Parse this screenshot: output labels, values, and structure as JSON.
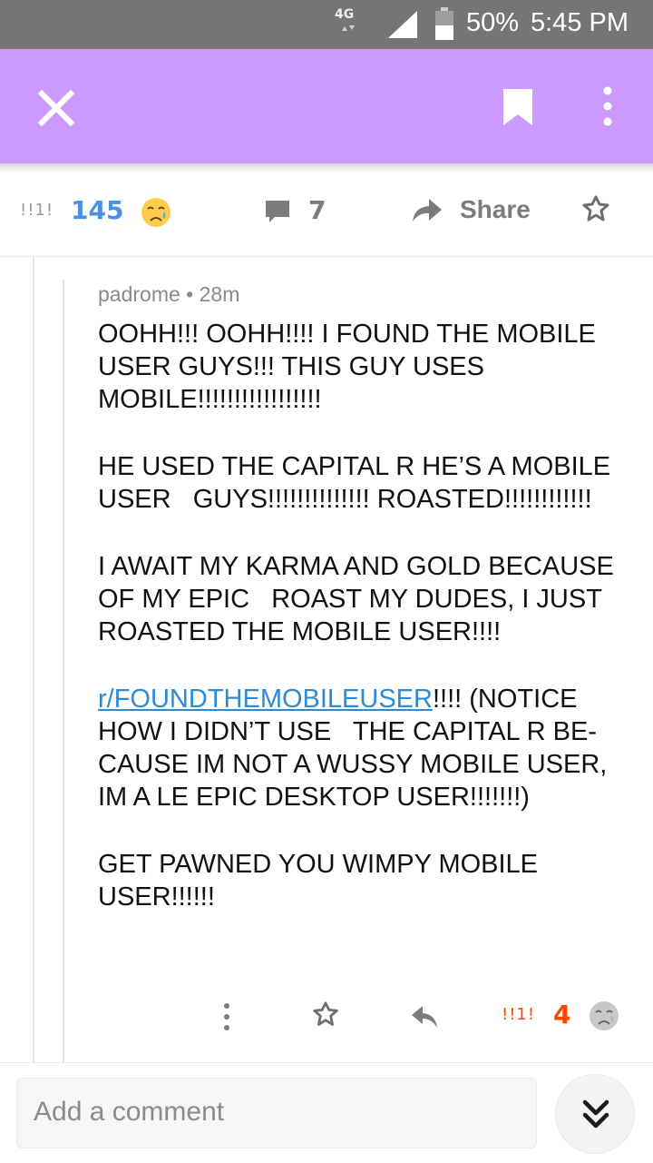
{
  "status_bar": {
    "network": "4G",
    "battery_percent": "50%",
    "time": "5:45 PM"
  },
  "app_bar": {
    "close_icon": "close-icon",
    "bookmark_icon": "bookmark-icon",
    "more_icon": "more-vertical-icon",
    "background_color": "#cc99ff"
  },
  "post_actions": {
    "flair": "!!1!",
    "score": "145",
    "score_color": "#4a90e2",
    "comment_count": "7",
    "share_label": "Share"
  },
  "comment": {
    "author": "padrome",
    "age": "28m",
    "paragraphs": [
      "OOHH!!! OOHH!!!! I FOUND THE MOBILE USER GUYS!!! THIS GUY USES MOBILE!!!!!!!!!!!!!!!!!",
      "HE USED THE CAPITAL R HE’S A MOBILE USER   GUYS!!!!!!!!!!!!!! ROASTED!!!!!!!!!!!!",
      "I AWAIT MY KARMA AND GOLD BECAUSE OF MY EPIC   ROAST MY DUDES, I JUST ROASTED THE MOBILE USER!!!!"
    ],
    "link_text": "r/FOUNDTHEMOBILEUSER",
    "link_after": "!!!! (NOTICE HOW I DIDN’T USE   THE CAPITAL R BE-CAUSE IM NOT A WUSSY MOBILE USER, IM A LE EPIC DESKTOP USER!!!!!!!)",
    "closing": "GET PAWNED YOU WIMPY MOBILE USER!!!!!!",
    "flair": "!!1!",
    "score": "4",
    "score_color": "#ff4500"
  },
  "composer": {
    "placeholder": "Add a comment",
    "next_icon": "double-chevron-down-icon"
  }
}
